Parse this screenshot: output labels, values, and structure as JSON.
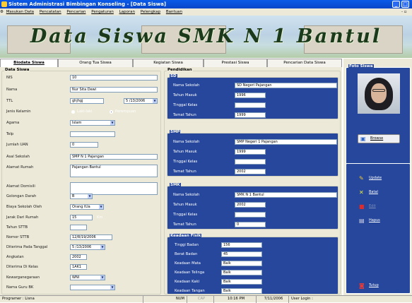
{
  "window": {
    "title": "Sistem Administrasi Bimbingan Konseling - [Data Siswa]"
  },
  "menu": [
    "Masukan Data",
    "Pencatatan",
    "Pencarian",
    "Pengaturan",
    "Laporan",
    "Pelengkap",
    "Bantuan"
  ],
  "banner": {
    "title": "Data Siswa SMK N 1 Bantul"
  },
  "tabs": [
    "Biodata Siswa",
    "Orang Tua Siswa",
    "Kegiatan Siswa",
    "Prestasi Siswa",
    "Pencarian Data Siswa"
  ],
  "data_siswa": {
    "legend": "Data Siswa",
    "nis": {
      "label": "NIS",
      "value": "10"
    },
    "nama": {
      "label": "Nama",
      "value": "Nur Sita Dewi"
    },
    "ttl": {
      "label": "TTL",
      "place": "ghjhgj",
      "date": "5 /13/2006"
    },
    "jenis_kelamin": {
      "label": "Jenis Kelamin",
      "opt1": "Laki-laki",
      "opt2": "Perempuan"
    },
    "agama": {
      "label": "Agama",
      "value": "Islam"
    },
    "telp": {
      "label": "Telp",
      "value": ""
    },
    "jumlah_uan": {
      "label": "Jumlah UAN",
      "value": "0"
    },
    "asal_sekolah": {
      "label": "Asal Sekolah",
      "value": "SMP N 1 Pajangan"
    },
    "alamat_rumah": {
      "label": "Alamat Rumah",
      "value": "Pajangan Bantul"
    },
    "alamat_domisili": {
      "label": "Alamat Domisili",
      "value": ""
    },
    "golongan_darah": {
      "label": "Golongan Darah",
      "value": "B"
    },
    "biaya": {
      "label": "Biaya Sekolah Oleh",
      "value": "Orang tUa"
    },
    "jarak": {
      "label": "Jarak Dari Rumah",
      "value": "15",
      "unit": "Km"
    },
    "tahun_sttb": {
      "label": "Tahun STTB",
      "value": ""
    },
    "nomor_sttb": {
      "label": "Nomor STTB",
      "value": "12/8/19/2006"
    },
    "diterima_tanggal": {
      "label": "Diterima Pada Tanggal",
      "value": "5 /13/2006"
    },
    "angkatan": {
      "label": "Angkatan",
      "value": "2002"
    },
    "diterima_kelas": {
      "label": "Diterima Di Kelas",
      "value": "1AK1"
    },
    "kewarganegaraan": {
      "label": "Kewarganegaraan",
      "value": "WNI"
    },
    "guru_bk": {
      "label": "Nama Guru BK",
      "value": ""
    }
  },
  "pendidikan": {
    "legend": "Pendidikan",
    "sd": {
      "legend": "SD",
      "nama_label": "Nama Sekolah",
      "nama": "SD Negeri Pajangan",
      "masuk_label": "Tahun Masuk",
      "masuk": "1996",
      "kelas_label": "Tinggal Kelas",
      "kelas": "",
      "tamat_label": "Tamat Tahun",
      "tamat": "1999"
    },
    "smp": {
      "legend": "SMP",
      "nama_label": "Nama Sekolah",
      "nama": "SMP Negeri 1 Pajangan",
      "masuk_label": "Tahun Masuk",
      "masuk": "1999",
      "kelas_label": "Tinggal Kelas",
      "kelas": "",
      "tamat_label": "Tamat Tahun",
      "tamat": "2002"
    },
    "smk": {
      "legend": "SMK",
      "nama_label": "Nama Sekolah",
      "nama": "SMK N 1 Bantul",
      "masuk_label": "Tahun Masuk",
      "masuk": "2002",
      "kelas_label": "Tinggal Kelas",
      "kelas": "",
      "tamat_label": "Tamat Tahun",
      "tamat": "0"
    }
  },
  "fisik": {
    "legend": "Keadaan Fisik",
    "tinggi": {
      "label": "Tinggi Badan",
      "value": "156"
    },
    "berat": {
      "label": "Berat Badan",
      "value": "45"
    },
    "mata": {
      "label": "Keadaan Mata",
      "value": "Baik"
    },
    "telinga": {
      "label": "Keadaan Telinga",
      "value": "Baik"
    },
    "kaki": {
      "label": "Keadaan Kaki",
      "value": "Baik"
    },
    "tangan": {
      "label": "Keadaan Tangan",
      "value": "Baik"
    }
  },
  "foto": {
    "legend": "Foto Siswa",
    "browse": "Browse"
  },
  "actions": {
    "update": "Update",
    "batal": "Batal",
    "edit": "Edit",
    "hapus": "Hapus",
    "tutup": "Tutup"
  },
  "status": {
    "programer": "Programer : Lisna",
    "num": "NUM",
    "cap": "CAP",
    "time": "10:16 PM",
    "date": "7/11/2006",
    "user": "User Login :"
  },
  "colors": {
    "titlebar": "#0a5be8",
    "group_blue": "#26479c",
    "pane": "#ece9d8"
  }
}
